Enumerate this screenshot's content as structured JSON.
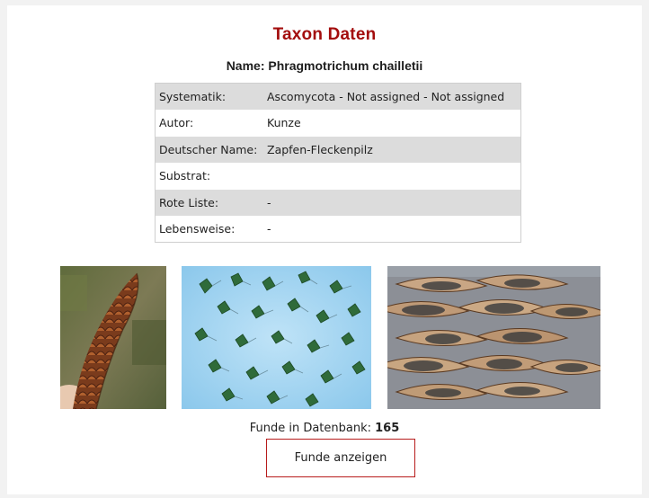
{
  "page": {
    "title": "Taxon Daten",
    "name_label": "Name:",
    "name_value": "Phragmotrichum chailletii"
  },
  "table": {
    "rows": [
      {
        "key": "Systematik:",
        "value": "Ascomycota - Not assigned - Not assigned"
      },
      {
        "key": "Autor:",
        "value": "Kunze"
      },
      {
        "key": "Deutscher Name:",
        "value": "Zapfen-Fleckenpilz"
      },
      {
        "key": "Substrat:",
        "value": ""
      },
      {
        "key": "Rote Liste:",
        "value": "-"
      },
      {
        "key": "Lebensweise:",
        "value": "-"
      }
    ]
  },
  "photos": [
    {
      "subject": "spruce-cone-photo"
    },
    {
      "subject": "microscope-spores-photo"
    },
    {
      "subject": "cone-scales-closeup-photo"
    }
  ],
  "funde": {
    "label": "Funde in Datenbank:",
    "count": "165",
    "button_label": "Funde anzeigen"
  },
  "colors": {
    "title": "#a30d0d",
    "button_border": "#b71c1c",
    "row_alt": "#dcdcdc"
  }
}
